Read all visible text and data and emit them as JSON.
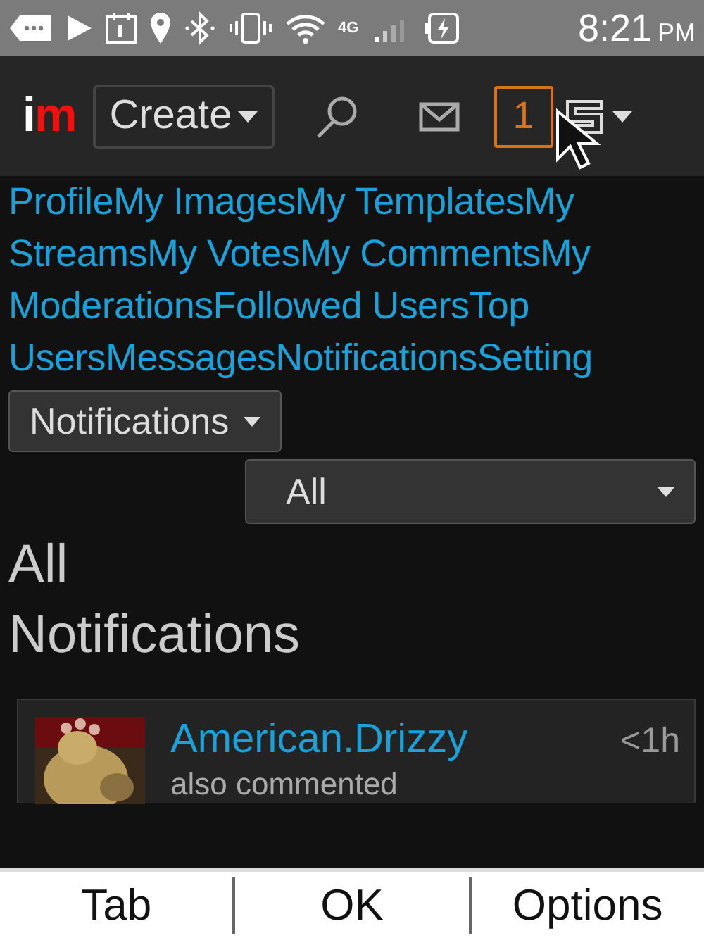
{
  "status_bar": {
    "time": "8:21",
    "am_pm": "PM",
    "network": "4G"
  },
  "header": {
    "logo": "im",
    "create_button": "Create",
    "notification_count": "1"
  },
  "nav_links": [
    "Profile",
    "My Images",
    "My Templates",
    "My Streams",
    "My Votes",
    "My Comments",
    "My Moderations",
    "Followed Users",
    "Top Users",
    "Messages",
    "Notifications",
    "Setting"
  ],
  "section_dropdown": {
    "label": "Notifications"
  },
  "filter_select": {
    "value": "All"
  },
  "heading": "All Notifications",
  "notifications": [
    {
      "user": "American.Drizzy",
      "time": "<1h",
      "text": "also commented"
    }
  ],
  "softkeys": [
    "Tab",
    "OK",
    "Options"
  ]
}
